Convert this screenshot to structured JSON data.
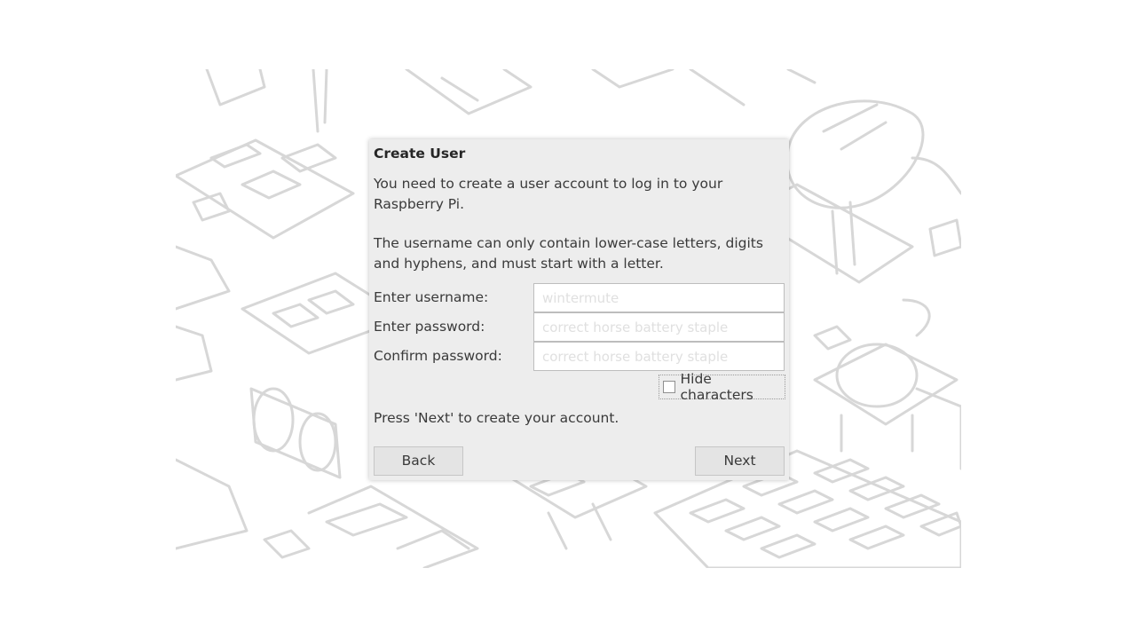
{
  "dialog": {
    "title": "Create User",
    "intro": "You need to create a user account to log in to your Raspberry Pi.",
    "rules": "The username can only contain lower-case letters, digits and hyphens, and must start with a letter.",
    "username_label": "Enter username:",
    "username_placeholder": "wintermute",
    "password_label": "Enter password:",
    "password_placeholder": "correct horse battery staple",
    "confirm_label": "Confirm password:",
    "confirm_placeholder": "correct horse battery staple",
    "hide_label": "Hide characters",
    "hide_checked": false,
    "press_next": "Press 'Next' to create your account.",
    "back_label": "Back",
    "next_label": "Next"
  },
  "colors": {
    "dialog_bg": "#ededed",
    "wallpaper_line": "#d6d6d6"
  }
}
